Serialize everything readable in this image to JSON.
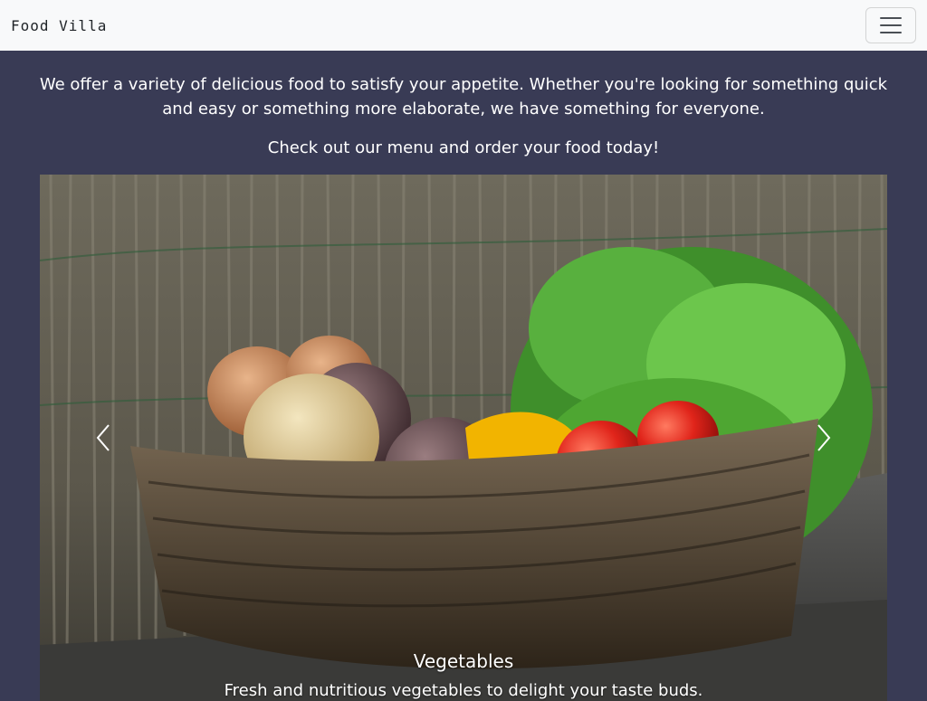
{
  "navbar": {
    "brand": "Food Villa",
    "toggler_icon": "hamburger-menu-icon"
  },
  "main": {
    "intro": "We offer a variety of delicious food to satisfy your appetite. Whether you're looking for something quick and easy or something more elaborate, we have something for everyone.",
    "cta": "Check out our menu and order your food today!"
  },
  "carousel": {
    "slide": {
      "title": "Vegetables",
      "text": "Fresh and nutritious vegetables to delight your taste buds."
    },
    "prev_icon": "chevron-left-icon",
    "next_icon": "chevron-right-icon"
  },
  "colors": {
    "background": "#393b55",
    "navbar": "#f8f9fa",
    "text": "#ffffff"
  }
}
